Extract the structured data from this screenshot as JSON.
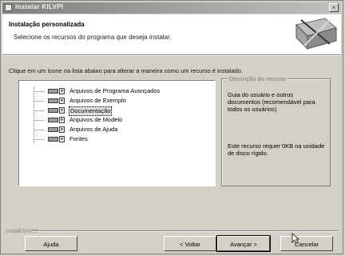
{
  "window": {
    "title": "Instalar KILVPI",
    "close_label": "×"
  },
  "header": {
    "title": "Instalação personalizada",
    "subtitle": "Selecione os recursos do programa que deseja instalar."
  },
  "instruction": "Clique em um ícone na lista abaixo para alterar a maneira como um recurso é instalado.",
  "tree": {
    "items": [
      {
        "label": "Arquivos de Programa Avançados",
        "selected": false
      },
      {
        "label": "Arquivos de Exemplo",
        "selected": false
      },
      {
        "label": "Documentação",
        "selected": true
      },
      {
        "label": "Arquivos de Modelo",
        "selected": false
      },
      {
        "label": "Arquivos de Ajuda",
        "selected": false
      },
      {
        "label": "Fontes",
        "selected": false
      }
    ]
  },
  "description": {
    "legend": "Descrição do recurso",
    "text": "Guia do usuário e outros documentos (recomendável para todos os usuários)",
    "requirement": "Este recurso requer 0KB na unidade de disco rígido."
  },
  "footer": {
    "label": "InstallShield",
    "help_label": "Ajuda",
    "back_label": "< Voltar",
    "next_label": "Avançar >",
    "cancel_label": "Cancelar"
  },
  "colors": {
    "dialog_bg": "#d4d0c8",
    "header_bg": "#ffffff",
    "title_gradient_start": "#808080"
  },
  "icons": {
    "feature_icon": "drive-icon",
    "dropdown_icon": "chevron-down-icon"
  }
}
